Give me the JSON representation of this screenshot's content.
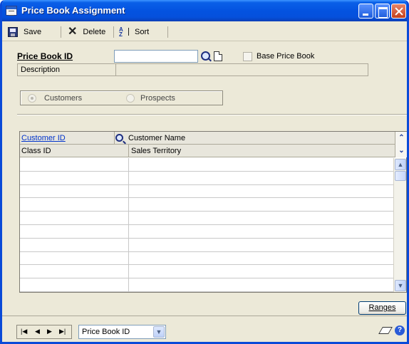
{
  "window": {
    "title": "Price Book Assignment"
  },
  "toolbar": {
    "save_label": "Save",
    "delete_label": "Delete",
    "sort_label": "Sort"
  },
  "form": {
    "price_book_id_label": "Price Book ID",
    "price_book_id_value": "",
    "base_price_book_label": "Base Price Book",
    "base_price_book_checked": false,
    "description_label": "Description",
    "description_value": ""
  },
  "radio_group": {
    "options": [
      "Customers",
      "Prospects"
    ],
    "selected": "Customers"
  },
  "grid": {
    "header_row1": {
      "col1": "Customer ID",
      "col2": "Customer Name"
    },
    "header_row2": {
      "col1": "Class ID",
      "col2": "Sales Territory"
    },
    "rows": [
      "",
      "",
      "",
      "",
      "",
      "",
      "",
      "",
      "",
      ""
    ]
  },
  "buttons": {
    "ranges_label": "Ranges"
  },
  "statusbar": {
    "nav_buttons": [
      "first",
      "previous",
      "next",
      "last"
    ],
    "sort_by_value": "Price Book ID"
  },
  "icons": [
    "window-icon",
    "save-icon",
    "delete-icon",
    "sort-icon",
    "lookup-icon",
    "note-icon",
    "eraser-icon",
    "help-icon"
  ]
}
